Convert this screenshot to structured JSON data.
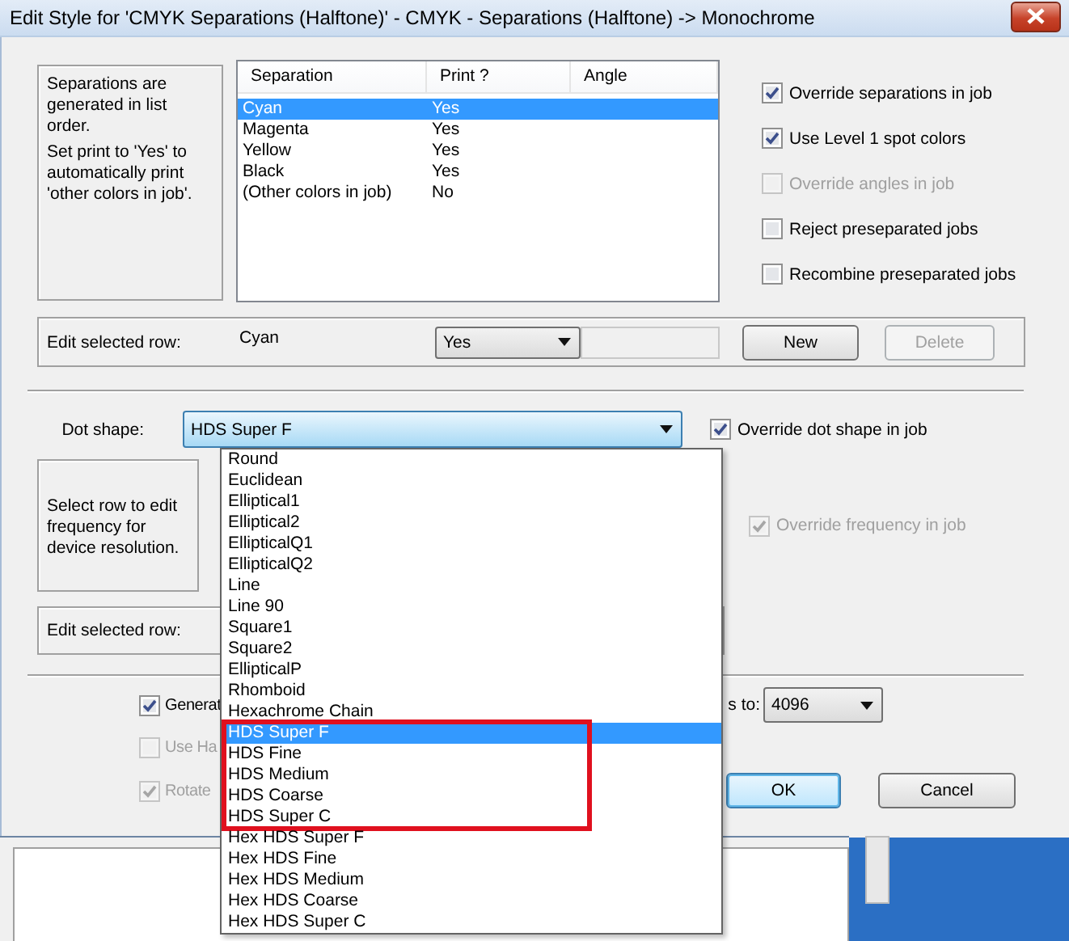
{
  "window": {
    "title": "Edit Style for 'CMYK Separations (Halftone)' - CMYK - Separations (Halftone) -> Monochrome"
  },
  "separations": {
    "note": "Separations are generated in list order.",
    "note_2": "Set print to 'Yes' to automatically print 'other colors in job'.",
    "columns": [
      "Separation",
      "Print ?",
      "Angle"
    ],
    "rows": [
      {
        "separation": "Cyan",
        "print": "Yes",
        "selected": true
      },
      {
        "separation": "Magenta",
        "print": "Yes",
        "selected": false
      },
      {
        "separation": "Yellow",
        "print": "Yes",
        "selected": false
      },
      {
        "separation": "Black",
        "print": "Yes",
        "selected": false
      },
      {
        "separation": "(Other colors in job)",
        "print": "No",
        "selected": false
      }
    ]
  },
  "job_options": [
    {
      "label": "Override separations in job",
      "checked": true,
      "disabled": false
    },
    {
      "label": "Use Level 1 spot colors",
      "checked": true,
      "disabled": false
    },
    {
      "label": "Override angles in job",
      "checked": false,
      "disabled": true
    },
    {
      "label": "Reject preseparated jobs",
      "checked": false,
      "disabled": false
    },
    {
      "label": "Recombine preseparated jobs",
      "checked": false,
      "disabled": false
    }
  ],
  "edit_row": {
    "label": "Edit selected row:",
    "value": "Cyan",
    "print_choice": "Yes",
    "buttons": [
      {
        "label": "New",
        "disabled": false
      },
      {
        "label": "Delete",
        "disabled": true
      }
    ]
  },
  "dot_shape": {
    "label": "Dot shape:",
    "value": "HDS Super F",
    "override": {
      "label": "Override dot shape in job",
      "checked": true,
      "disabled": false
    },
    "options": [
      {
        "label": "Round",
        "selected": false,
        "marked": false
      },
      {
        "label": "Euclidean",
        "selected": false,
        "marked": false
      },
      {
        "label": "Elliptical1",
        "selected": false,
        "marked": false
      },
      {
        "label": "Elliptical2",
        "selected": false,
        "marked": false
      },
      {
        "label": "EllipticalQ1",
        "selected": false,
        "marked": false
      },
      {
        "label": "EllipticalQ2",
        "selected": false,
        "marked": false
      },
      {
        "label": "Line",
        "selected": false,
        "marked": false
      },
      {
        "label": "Line 90",
        "selected": false,
        "marked": false
      },
      {
        "label": "Square1",
        "selected": false,
        "marked": false
      },
      {
        "label": "Square2",
        "selected": false,
        "marked": false
      },
      {
        "label": "EllipticalP",
        "selected": false,
        "marked": false
      },
      {
        "label": "Rhomboid",
        "selected": false,
        "marked": false
      },
      {
        "label": "Hexachrome Chain",
        "selected": false,
        "marked": false
      },
      {
        "label": "HDS Super F",
        "selected": true,
        "marked": true
      },
      {
        "label": "HDS Fine",
        "selected": false,
        "marked": true
      },
      {
        "label": "HDS Medium",
        "selected": false,
        "marked": true
      },
      {
        "label": "HDS Coarse",
        "selected": false,
        "marked": true
      },
      {
        "label": "HDS Super C",
        "selected": false,
        "marked": true
      },
      {
        "label": "Hex HDS Super F",
        "selected": false,
        "marked": false
      },
      {
        "label": "Hex HDS Fine",
        "selected": false,
        "marked": false
      },
      {
        "label": "Hex HDS Medium",
        "selected": false,
        "marked": false
      },
      {
        "label": "Hex HDS Coarse",
        "selected": false,
        "marked": false
      },
      {
        "label": "Hex HDS Super C",
        "selected": false,
        "marked": false
      }
    ]
  },
  "frequency": {
    "note": "Select row to edit frequency for device resolution.",
    "edit_label": "Edit selected row:",
    "override": {
      "label": "Override frequency in job",
      "checked": true,
      "disabled": true
    }
  },
  "options": [
    {
      "label": "Generat",
      "checked": true,
      "disabled": false
    },
    {
      "label": "Use Ha",
      "checked": false,
      "disabled": true
    },
    {
      "label": "Rotate",
      "checked": true,
      "disabled": true
    }
  ],
  "limit": {
    "label": "s to:",
    "value": "4096"
  },
  "buttons": [
    {
      "label": "OK",
      "default": true
    },
    {
      "label": "Cancel",
      "default": false
    }
  ]
}
